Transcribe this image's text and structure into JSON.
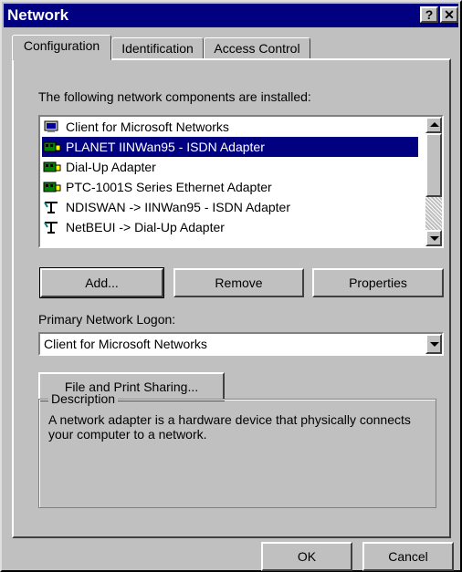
{
  "window": {
    "title": "Network",
    "help_glyph": "?",
    "close_glyph": "✕"
  },
  "tabs": [
    {
      "label": "Configuration"
    },
    {
      "label": "Identification"
    },
    {
      "label": "Access Control"
    }
  ],
  "components": {
    "label": "The following network components are installed:",
    "items": [
      {
        "label": "Client for Microsoft Networks",
        "icon": "client-icon"
      },
      {
        "label": "PLANET IINWan95 - ISDN Adapter",
        "icon": "adapter-icon"
      },
      {
        "label": "Dial-Up Adapter",
        "icon": "adapter-icon"
      },
      {
        "label": "PTC-1001S Series Ethernet Adapter",
        "icon": "adapter-icon"
      },
      {
        "label": "NDISWAN -> IINWan95 - ISDN Adapter",
        "icon": "protocol-icon"
      },
      {
        "label": "NetBEUI -> Dial-Up Adapter",
        "icon": "protocol-icon"
      }
    ],
    "selected_index": 1
  },
  "buttons": {
    "add": "Add...",
    "remove": "Remove",
    "properties": "Properties",
    "file_print_sharing": "File and Print Sharing...",
    "ok": "OK",
    "cancel": "Cancel"
  },
  "logon": {
    "label": "Primary Network Logon:",
    "selected": "Client for Microsoft Networks"
  },
  "description": {
    "title": "Description",
    "text": "A network adapter is a hardware device that physically connects your computer to a network."
  }
}
